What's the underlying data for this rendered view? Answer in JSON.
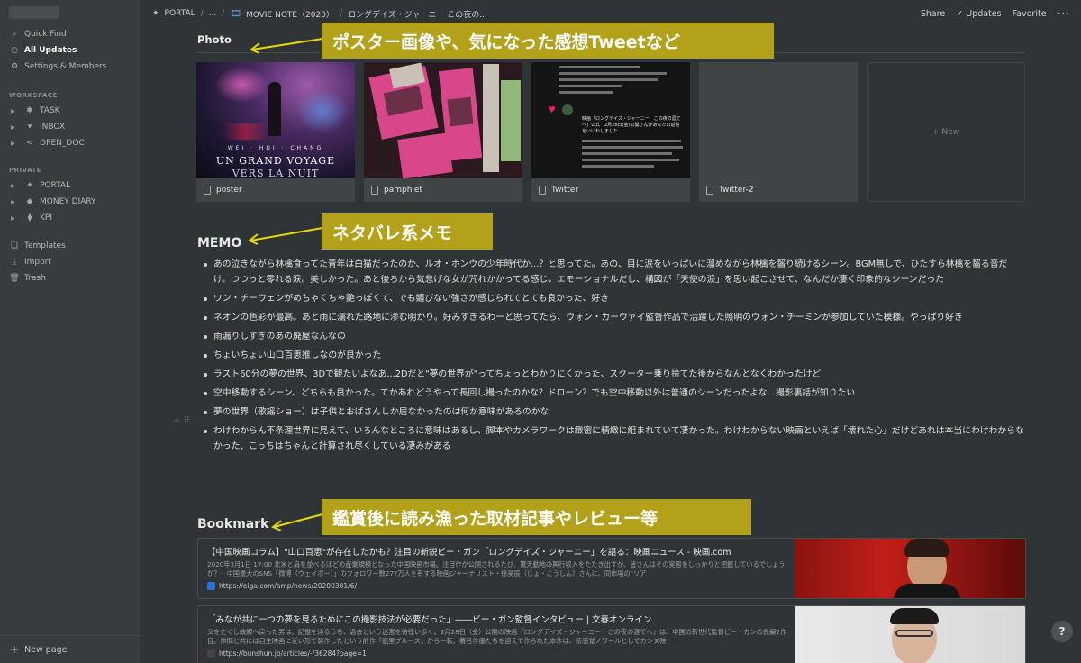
{
  "sidebar": {
    "top": [
      {
        "label": "Quick Find",
        "icon": "search-icon"
      },
      {
        "label": "All Updates",
        "icon": "clock-icon"
      },
      {
        "label": "Settings & Members",
        "icon": "gear-icon"
      }
    ],
    "workspace_label": "WORKSPACE",
    "workspace": [
      {
        "label": "TASK"
      },
      {
        "label": "INBOX"
      },
      {
        "label": "OPEN_DOC"
      }
    ],
    "private_label": "PRIVATE",
    "private": [
      {
        "label": "PORTAL"
      },
      {
        "label": "MONEY DIARY"
      },
      {
        "label": "KPI"
      }
    ],
    "bottom": [
      {
        "label": "Templates"
      },
      {
        "label": "Import"
      },
      {
        "label": "Trash"
      }
    ],
    "new_page": "New page"
  },
  "topbar": {
    "crumbs": [
      "PORTAL",
      "...",
      "MOVIE NOTE（2020）",
      "ロングデイズ・ジャーニー この夜の..."
    ],
    "share": "Share",
    "updates": "Updates",
    "favorite": "Favorite"
  },
  "photo": {
    "heading": "Photo",
    "cards": [
      {
        "caption": "poster"
      },
      {
        "caption": "pamphlet"
      },
      {
        "caption": "Twitter"
      },
      {
        "caption": "Twitter-2"
      }
    ],
    "new_label": "+ New",
    "poster_text": {
      "line0": "WEI · HUI · CHANG",
      "line1": "UN GRAND VOYAGE",
      "line2": "VERS LA NUIT"
    }
  },
  "memo": {
    "heading": "MEMO",
    "items": [
      "あの泣きながら林檎食ってた青年は白猫だったのか、ルオ・ホンウの少年時代か...？と思ってた。あの、目に涙をいっぱいに溜めながら林檎を齧り続けるシーン。BGM無しで、ひたすら林檎を齧る音だけ。つつっと零れる涙。美しかった。あと後ろから気怠げな女が咒れかかってる感じ。エモーショナルだし、構図が「天使の涙」を思い起こさせて、なんだか凄く印象的なシーンだった",
      "ワン・チーウェンがめちゃくちゃ艶っぽくて、でも媚びない強さが感じられてとても良かった、好き",
      "ネオンの色彩が最高。あと雨に濡れた路地に滲む明かり。好みすぎるわーと思ってたら、ウォン・カーウァイ監督作品で活躍した照明のウォン・チーミンが参加していた模様。やっぱり好き",
      "雨漏りしすぎのあの廃屋なんなの",
      "ちょいちょい山口百恵推しなのが良かった",
      "ラスト60分の夢の世界、3Dで観たいよなあ...2Dだと\"夢の世界が\"ってちょっとわかりにくかった、スクーター乗り捨てた後からなんとなくわかったけど",
      "空中移動するシーン、どちらも良かった。てかあれどうやって長回し撮ったのかな？ドローン？でも空中移動以外は普通のシーンだったよな...撮影裏話が知りたい",
      "夢の世界（歌謡ショー）は子供とおばさんしか居なかったのは何か意味があるのかな",
      "わけわからん不条理世界に見えて、いろんなところに意味はあるし、脚本やカメラワークは緻密に精緻に組まれていて凄かった。わけわからない映画といえば「壊れた心」だけどあれは本当にわけわからなかった、こっちはちゃんと計算され尽くしている凄みがある"
    ]
  },
  "bookmark": {
    "heading": "Bookmark",
    "items": [
      {
        "title": "【中国映画コラム】\"山口百恵\"が存在したかも？注目の新鋭ビー・ガン「ロングデイズ・ジャーニー」を語る：映画ニュース - 映画.com",
        "desc": "2020年3月1日 17:00 北米と肩を並べるほどの産業規模となった中国映画市場。注目作が公開されるたび、驚天動地の興行収入をたたき出すが、皆さんはその実態をしっかりと把握しているでしょうか？　中国最大のSNS「微博（ウェイボー）」のフォロワー数277万人を有する映画ジャーナリスト・徐昊辰（じょ・こうしん）さんに、同市場の\"リア",
        "url": "https://eiga.com/amp/news/20200301/6/"
      },
      {
        "title": "「みなが共に一つの夢を見るためにこの撮影技法が必要だった」――ビー・ガン監督インタビュー | 文春オンライン",
        "desc": "父を亡くし故郷へ戻った男は、記憶を辿るうち、過去という迷宮を彷徨い歩く。2月28日（金）公開の映画『ロングデイズ・ジャーニー　この夜の涯てへ』は、中国の新世代監督ビー・ガンの長編2作目。仲間と共には自主映画に近い形で製作したという前作『凱里ブルース』から一転、著名俳優たちを迎えて作られた本作は、新感覚ノワールとしてカンヌ映",
        "url": "https://bunshun.jp/articles/-/36284?page=1"
      }
    ]
  },
  "annotations": {
    "photo": "ポスター画像や、気になった感想Tweetなど",
    "memo": "ネタバレ系メモ",
    "bookmark": "鑑賞後に読み漁った取材記事やレビュー等"
  },
  "twitter_text": {
    "header": "映画『ロングデイズ・ジャーニー　この夜の涯てへ』公式　2月28日(金)公開さんがあなたの返信をいいねしました"
  },
  "help": "?"
}
